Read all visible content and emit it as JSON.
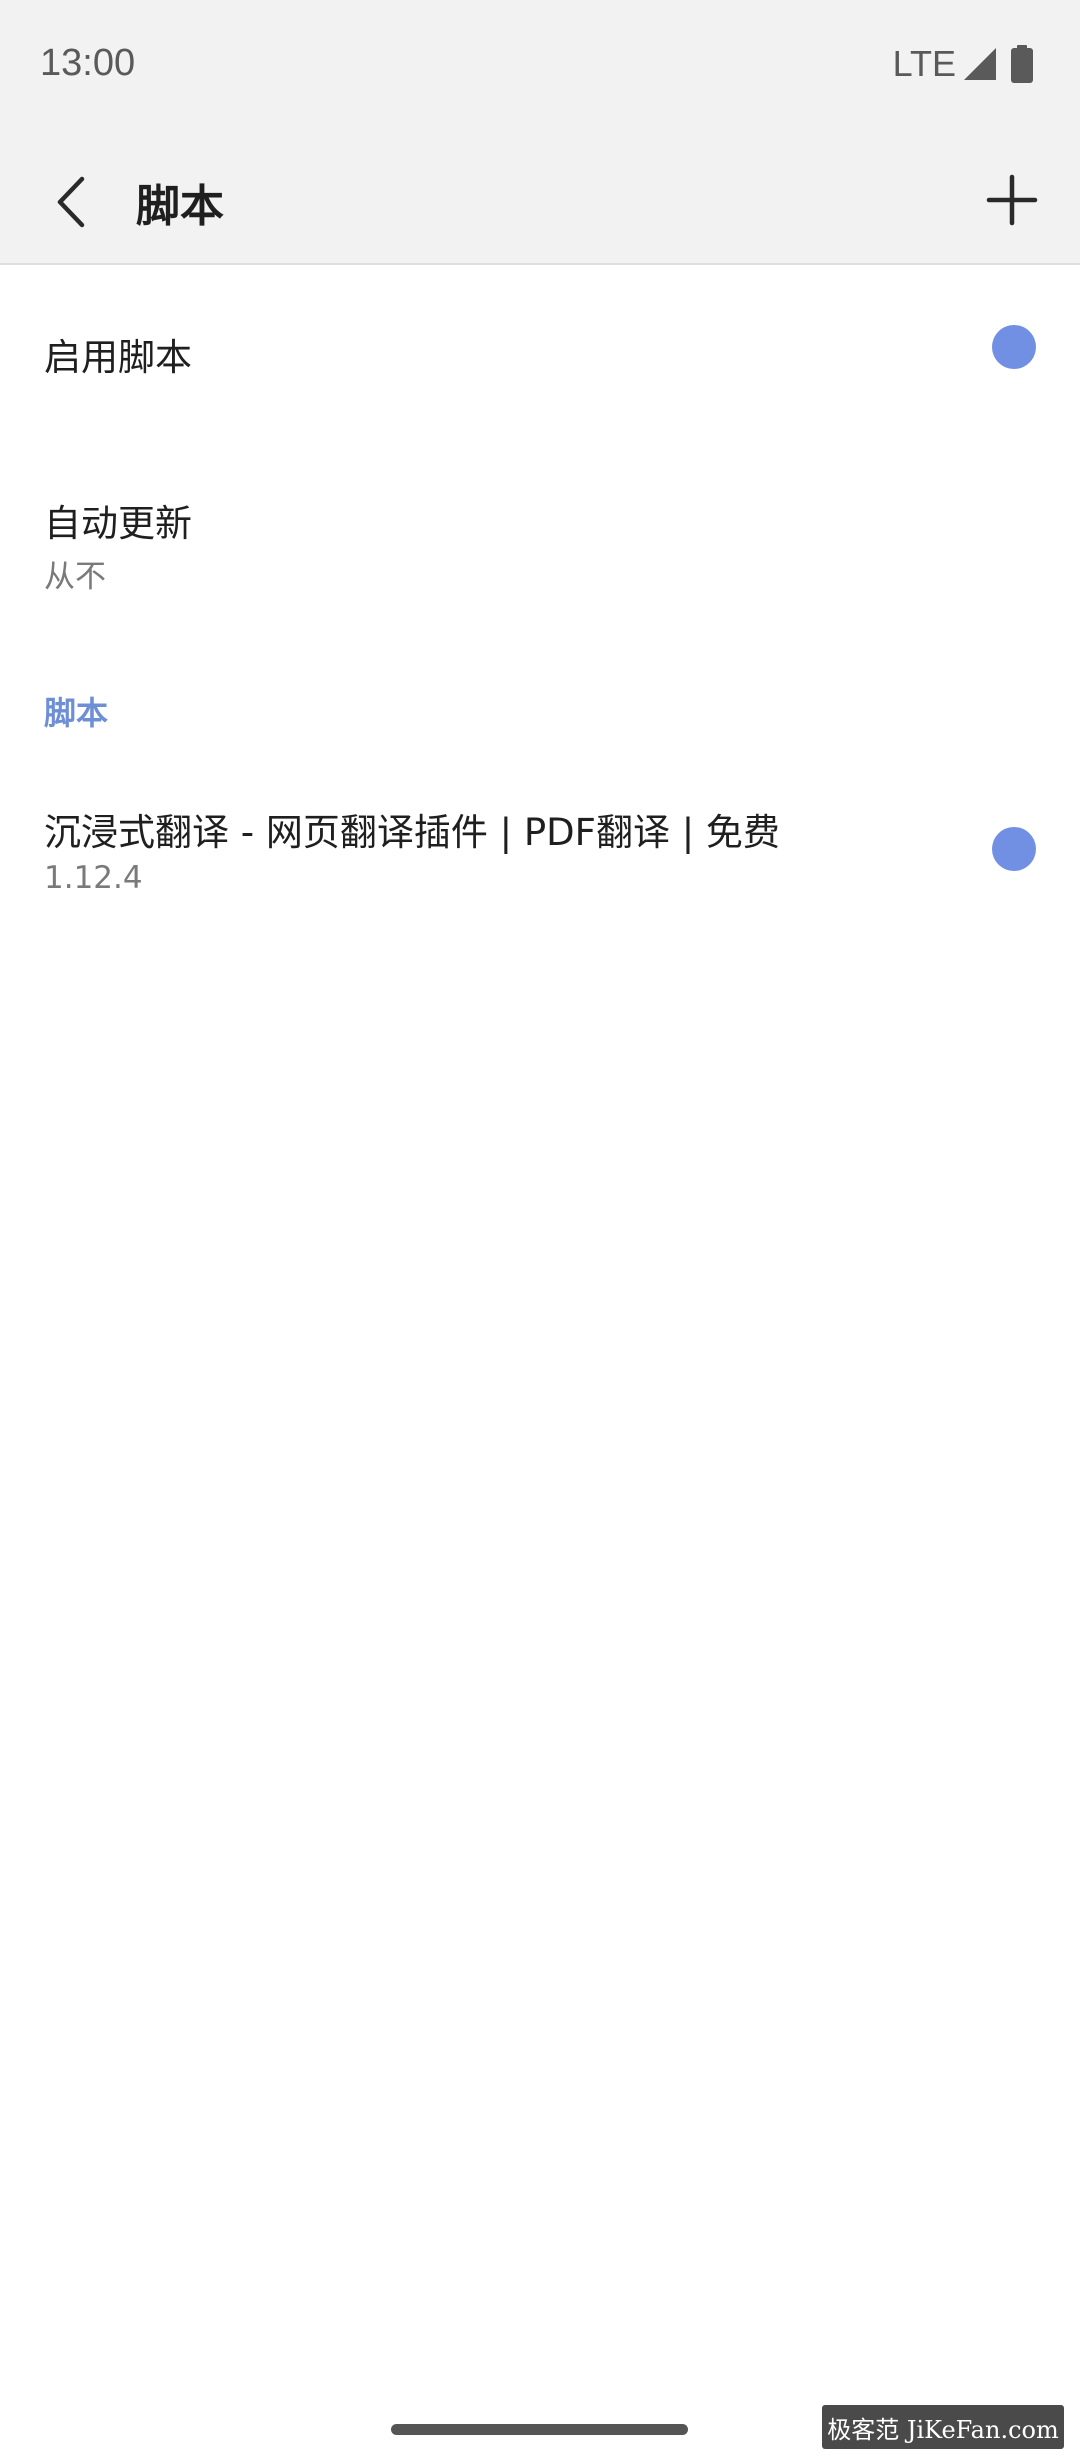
{
  "status_bar": {
    "time": "13:00",
    "network": "LTE",
    "signal_icon": "cell-signal-icon",
    "battery_icon": "battery-icon"
  },
  "app_bar": {
    "back_icon": "chevron-left-icon",
    "title": "脚本",
    "add_icon": "plus-icon"
  },
  "settings": {
    "enable_scripts": {
      "label": "启用脚本",
      "enabled": true
    },
    "auto_update": {
      "label": "自动更新",
      "value": "从不"
    }
  },
  "scripts_section": {
    "header": "脚本",
    "items": [
      {
        "name": "沉浸式翻译 - 网页翻译插件 | PDF翻译 | 免费",
        "version": "1.12.4",
        "enabled": true
      }
    ]
  },
  "watermark": {
    "text": "极客范 JiKeFan.com"
  },
  "colors": {
    "accent": "#7190e3",
    "section_header": "#6e8fd6",
    "bar_background": "#f2f2f2",
    "text_primary": "#1f1f1f",
    "text_secondary": "#7a7a7a"
  }
}
